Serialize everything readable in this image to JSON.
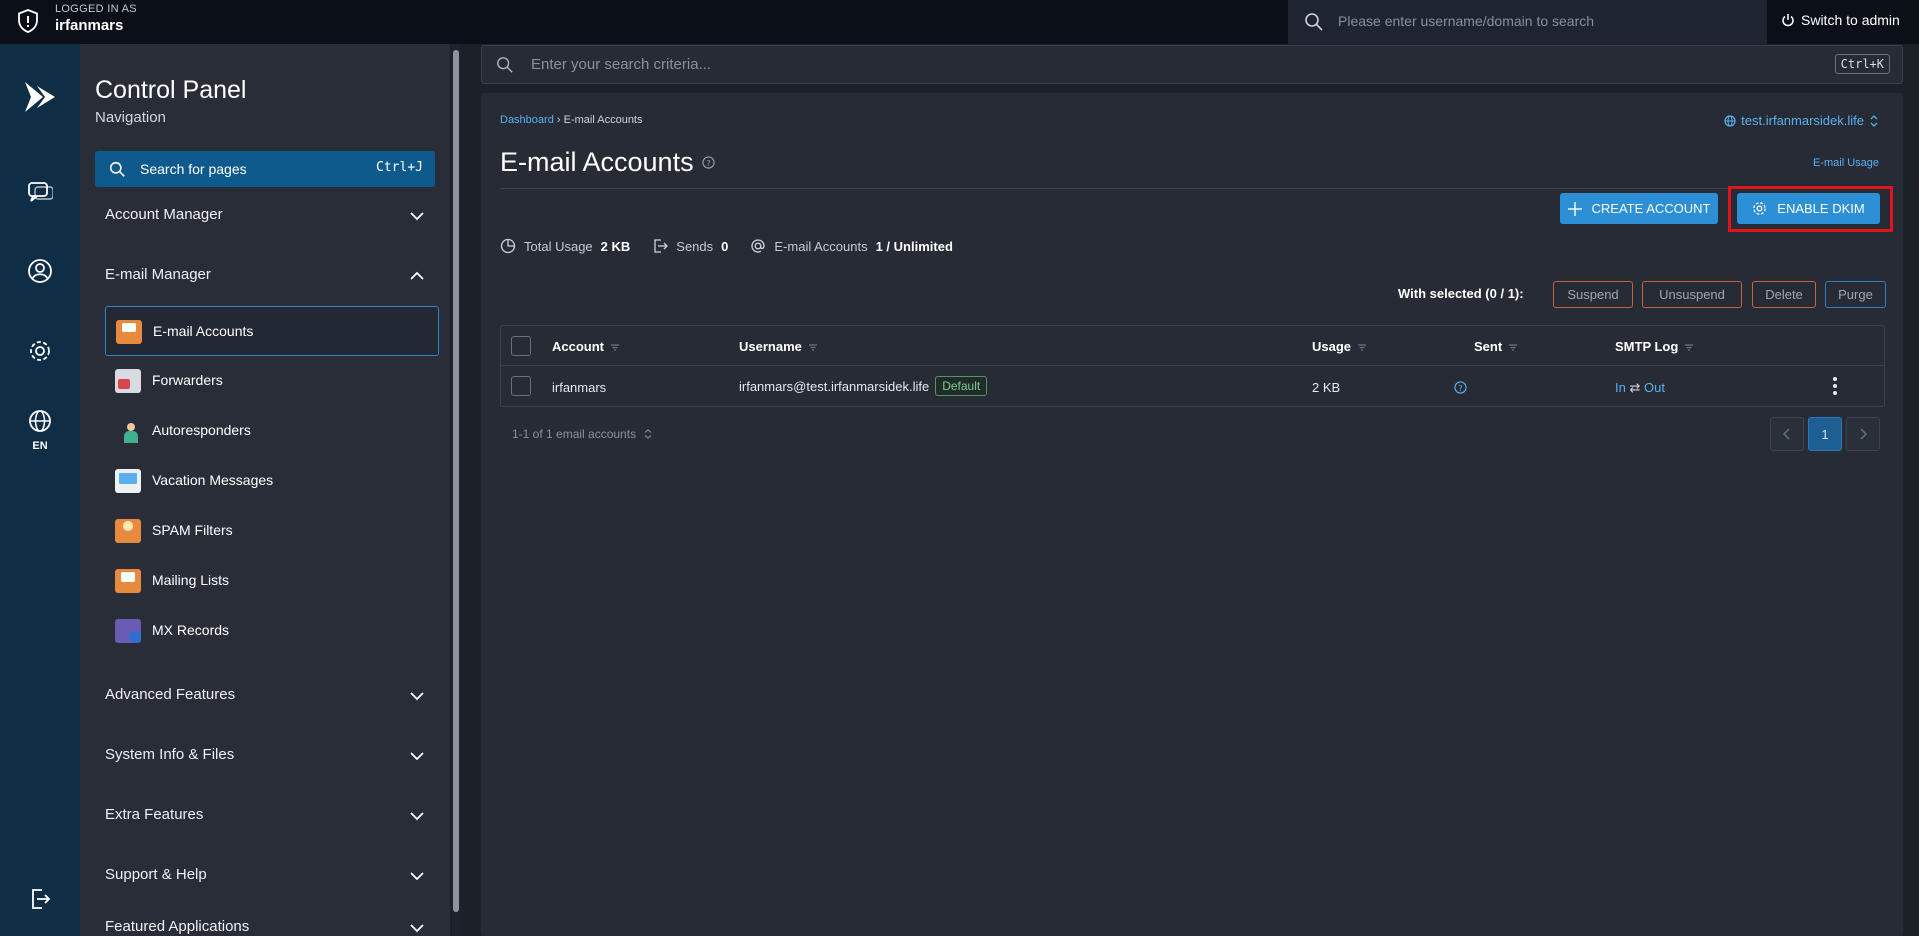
{
  "topbar": {
    "logged_label": "LOGGED IN AS",
    "username": "irfanmars",
    "user_search_placeholder": "Please enter username/domain to search",
    "switch_label": "Switch to admin"
  },
  "rail": {
    "lang": "EN"
  },
  "nav": {
    "title": "Control Panel",
    "subtitle": "Navigation",
    "search_label": "Search for pages",
    "search_shortcut": "Ctrl+J",
    "sections": {
      "account_manager": "Account Manager",
      "email_manager": "E-mail Manager",
      "advanced": "Advanced Features",
      "sysinfo": "System Info & Files",
      "extra": "Extra Features",
      "support": "Support & Help",
      "featured": "Featured Applications"
    },
    "email_items": [
      "E-mail Accounts",
      "Forwarders",
      "Autoresponders",
      "Vacation Messages",
      "SPAM Filters",
      "Mailing Lists",
      "MX Records"
    ]
  },
  "global_search": {
    "placeholder": "Enter your search criteria...",
    "shortcut": "Ctrl+K"
  },
  "page": {
    "breadcrumb": {
      "home": "Dashboard",
      "current": "E-mail Accounts"
    },
    "domain": "test.irfanmarsidek.life",
    "title": "E-mail Accounts",
    "usage_link": "E-mail Usage",
    "create_label": "CREATE ACCOUNT",
    "dkim_label": "ENABLE DKIM",
    "stats": {
      "total_usage_label": "Total Usage",
      "total_usage_value": "2 KB",
      "sends_label": "Sends",
      "sends_value": "0",
      "accounts_label": "E-mail Accounts",
      "accounts_value": "1 / Unlimited"
    },
    "with_selected": "With selected (0 / 1):",
    "actions": {
      "suspend": "Suspend",
      "unsuspend": "Unsuspend",
      "delete": "Delete",
      "purge": "Purge"
    },
    "table": {
      "headers": {
        "account": "Account",
        "username": "Username",
        "usage": "Usage",
        "sent": "Sent",
        "smtp": "SMTP Log"
      },
      "rows": [
        {
          "account": "irfanmars",
          "username": "irfanmars@test.irfanmarsidek.life",
          "badge": "Default",
          "usage": "2 KB",
          "smtp_in": "In",
          "smtp_arrow": "⇄",
          "smtp_out": "Out"
        }
      ]
    },
    "pagination": {
      "info": "1-1 of 1 email accounts",
      "current": "1"
    }
  }
}
